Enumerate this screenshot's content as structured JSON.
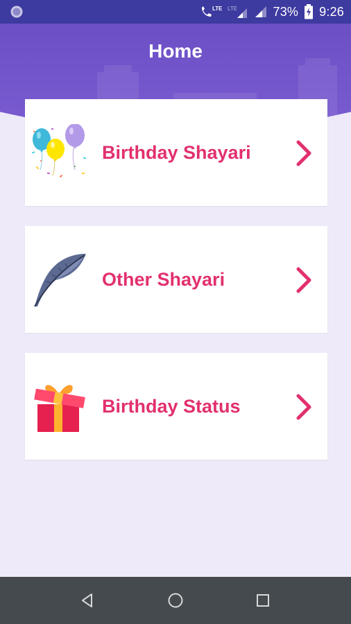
{
  "status_bar": {
    "lte_label": "LTE",
    "lte2_label": "LTE",
    "battery_percent": "73%",
    "time": "9:26"
  },
  "header": {
    "title": "Home"
  },
  "menu": {
    "items": [
      {
        "label": "Birthday Shayari",
        "icon": "balloons-icon"
      },
      {
        "label": "Other Shayari",
        "icon": "feather-icon"
      },
      {
        "label": "Birthday Status",
        "icon": "gift-icon"
      }
    ]
  },
  "colors": {
    "status_bar": "#3d3aa0",
    "header": "#7456cc",
    "background": "#efeaf9",
    "accent": "#e2306f",
    "nav_bar": "#454a4f"
  },
  "nav": {
    "buttons": [
      "back-icon",
      "home-icon",
      "recents-icon"
    ]
  }
}
